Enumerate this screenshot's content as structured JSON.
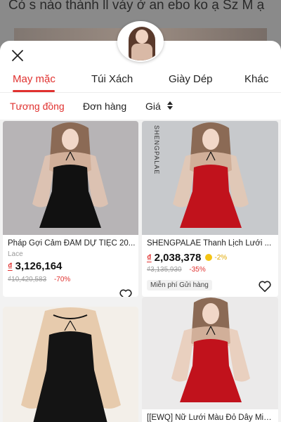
{
  "background": {
    "text": "Có s nào thành ll váy ở an ebo ko ạ Sz M ạ"
  },
  "tabs": [
    {
      "label": "May mặc",
      "active": true
    },
    {
      "label": "Túi Xách",
      "active": false
    },
    {
      "label": "Giày Dép",
      "active": false
    },
    {
      "label": "Khác",
      "active": false
    }
  ],
  "sorts": [
    {
      "label": "Tương đồng",
      "active": true
    },
    {
      "label": "Đơn hàng",
      "active": false
    },
    {
      "label": "Giá",
      "active": false
    }
  ],
  "products": [
    {
      "title": "Pháp Gợi Cảm ĐẦM DỰ TIỆC 20...",
      "brand": "Lace",
      "currency": "₫",
      "price": "3,126,164",
      "old_price": "₫10,420,583",
      "discount": "-70%",
      "dress_color": "#111111"
    },
    {
      "title": "SHENGPALAE Thanh Lịch Lưới ...",
      "watermark": "SHENGPALAE",
      "currency": "₫",
      "price": "2,038,378",
      "coin": "-2%",
      "old_price": "₫3,135,930",
      "discount": "-35%",
      "shipping": "Miễn phí Gửi hàng",
      "dress_color": "#c1121c"
    },
    {
      "title": "",
      "dress_color": "#111111"
    },
    {
      "title": "[[EWQ] Nữ Lưới Màu Đỏ Dây Miế...",
      "dress_color": "#c1121c"
    }
  ],
  "colors": {
    "accent": "#e0312f",
    "price_text": "#111111"
  }
}
